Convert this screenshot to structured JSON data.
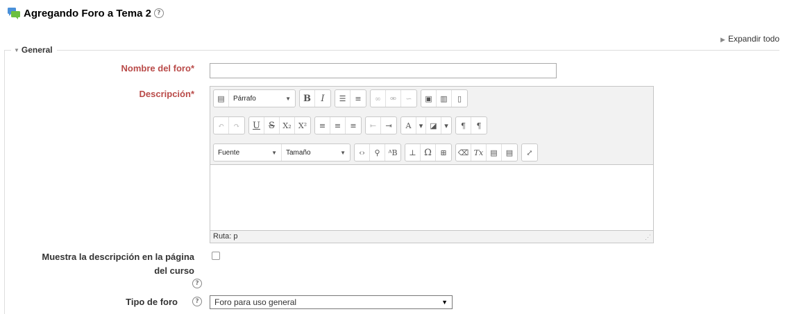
{
  "header": {
    "title": "Agregando Foro a Tema 2",
    "help_icon": "question-circle-icon",
    "forum_icon": "forum-icon"
  },
  "expand_all": "Expandir todo",
  "section": {
    "legend": "General"
  },
  "form": {
    "forum_name": {
      "label": "Nombre del foro",
      "required_mark": "*",
      "value": ""
    },
    "description": {
      "label": "Descripción",
      "required_mark": "*"
    },
    "editor": {
      "format_select": "Párrafo",
      "font_select": "Fuente",
      "size_select": "Tamaño",
      "path": "Ruta: p",
      "content": ""
    },
    "show_description": {
      "label_line1": "Muestra la descripción en la página",
      "label_line2": "del curso",
      "checked": false
    },
    "forum_type": {
      "label": "Tipo de foro",
      "selected": "Foro para uso general"
    }
  },
  "colors": {
    "required": "#b94a48",
    "border": "#c5c5c5",
    "toolbar_bg": "#f2f2f2"
  }
}
